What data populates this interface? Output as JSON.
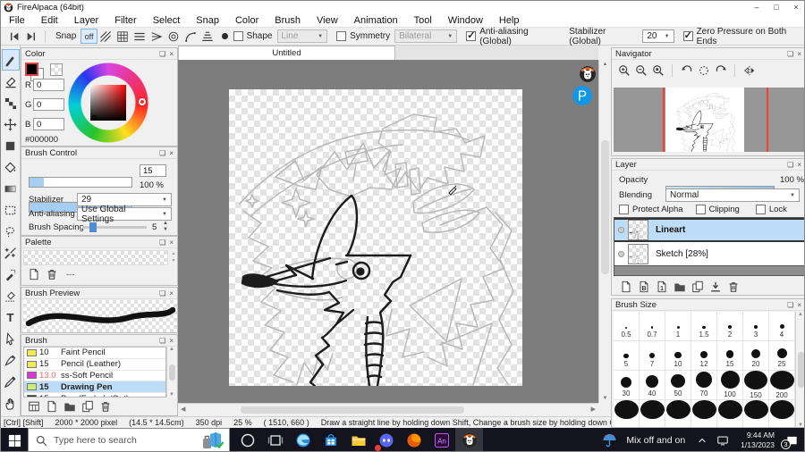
{
  "window": {
    "title": "FireAlpaca (64bit)",
    "minimize": "–",
    "maximize": "□",
    "close": "×"
  },
  "menu": {
    "items": [
      "File",
      "Edit",
      "Layer",
      "Filter",
      "Select",
      "Snap",
      "Color",
      "Brush",
      "View",
      "Animation",
      "Tool",
      "Window",
      "Help"
    ]
  },
  "toolbar": {
    "snap_label": "Snap",
    "snap_off_label": "off",
    "snap_icons": [
      "snap-parallel",
      "snap-grid",
      "snap-horizontal",
      "snap-vanishing",
      "snap-concentric",
      "snap-curve",
      "snap-perspective"
    ],
    "shape_label": "Shape",
    "shape_value": "Line",
    "symmetry_label": "Symmetry",
    "symmetry_value": "Bilateral",
    "antialias_label": "Anti-aliasing (Global)",
    "stabilizer_label": "Stabilizer (Global)",
    "stabilizer_value": "20",
    "zero_pressure_label": "Zero Pressure on Both Ends"
  },
  "tools": {
    "items": [
      "brush",
      "eraser",
      "smudge",
      "move",
      "shape",
      "bucket",
      "gradient",
      "select-rect",
      "lasso",
      "magic-wand",
      "select-pen",
      "select-eraser",
      "text",
      "pointer",
      "pen",
      "eyedropper",
      "hand"
    ],
    "selected": "brush"
  },
  "color_panel": {
    "title": "Color",
    "r_label": "R",
    "g_label": "G",
    "b_label": "B",
    "r_value": "0",
    "g_value": "0",
    "b_value": "0",
    "hex": "#000000"
  },
  "brush_control": {
    "title": "Brush Control",
    "size_value": "15",
    "opacity_value": "100 %",
    "stabilizer_label": "Stabilizer",
    "stabilizer_value": "29",
    "antialias_label": "Anti-aliasing",
    "antialias_value": "Use Global Settings",
    "spacing_label": "Brush Spacing",
    "spacing_value": "5"
  },
  "palette": {
    "title": "Palette",
    "separator": "---",
    "footer_icons": [
      "add-color",
      "delete-color"
    ]
  },
  "brush_preview": {
    "title": "Brush Preview"
  },
  "brush_panel": {
    "title": "Brush",
    "brushes": [
      {
        "size": "10",
        "name": "Faint Pencil",
        "swatch": "#f2ea55",
        "size_red": false,
        "selected": false
      },
      {
        "size": "15",
        "name": "Pencil (Leather)",
        "swatch": "#f2ea55",
        "size_red": false,
        "selected": false
      },
      {
        "size": "13.0",
        "name": "ss-Soft Pencil",
        "swatch": "#d935d9",
        "size_red": true,
        "selected": false
      },
      {
        "size": "15",
        "name": "Drawing Pen",
        "swatch": "#cdeb7a",
        "size_red": false,
        "selected": true
      },
      {
        "size": "15",
        "name": "Pen (Fade In/Out)",
        "swatch": "#2e2e2e",
        "size_red": false,
        "selected": false
      }
    ],
    "footer_icons": [
      "brush-library",
      "add-brush",
      "brush-folder",
      "duplicate-brush",
      "delete-brush"
    ]
  },
  "document": {
    "tab": "Untitled"
  },
  "navigator": {
    "title": "Navigator",
    "toolbar_icons": [
      "zoom-in",
      "zoom-out",
      "zoom-reset",
      "|",
      "rotate-left",
      "rotate-reset",
      "rotate-right",
      "|",
      "flip-horizontal"
    ]
  },
  "layer_panel": {
    "title": "Layer",
    "opacity_label": "Opacity",
    "opacity_value": "100 %",
    "blending_label": "Blending",
    "blending_value": "Normal",
    "protect_alpha_label": "Protect Alpha",
    "clipping_label": "Clipping",
    "lock_label": "Lock",
    "layers": [
      {
        "name": "Lineart",
        "selected": true
      },
      {
        "name": "Sketch [28%]",
        "selected": false
      }
    ],
    "footer_icons": [
      "add-layer",
      "add-8bit-layer",
      "add-1bit-layer",
      "layer-folder",
      "duplicate-layer",
      "merge-down",
      "delete-layer"
    ]
  },
  "brush_size_panel": {
    "title": "Brush Size",
    "sizes": [
      "0.5",
      "0.7",
      "1",
      "1.5",
      "2",
      "3",
      "4",
      "5",
      "7",
      "10",
      "12",
      "15",
      "20",
      "25",
      "30",
      "40",
      "50",
      "70",
      "100",
      "150",
      "200"
    ]
  },
  "status_bar": {
    "modifiers": "[Ctrl] [Shift]",
    "dimensions": "2000 * 2000 pixel",
    "physical": "(14.5 * 14.5cm)",
    "dpi": "350 dpi",
    "zoom": "25 %",
    "coords": "( 1510, 660 )",
    "hint": "Draw a straight line by holding down Shift, Change a brush size by holding down Ctrl, Alt, and dragging"
  },
  "taskbar": {
    "search_placeholder": "Type here to search",
    "apps": [
      "cortana",
      "task-view",
      "edge",
      "store",
      "explorer",
      "discord",
      "firefox",
      "animate",
      "firealpaca"
    ],
    "active_app": "firealpaca",
    "tray_text": "Mix off and on",
    "time": "9:44 AM",
    "date": "1/13/2023",
    "notification_count": "3"
  },
  "colors": {
    "selection_blue": "#bcdcf8",
    "slider_blue": "#a6cdf2",
    "canvas_gray": "#7d7d7d",
    "taskbar_bg": "#14141e",
    "guide_red": "#ff3b30",
    "size_red_text": "#e06666"
  }
}
